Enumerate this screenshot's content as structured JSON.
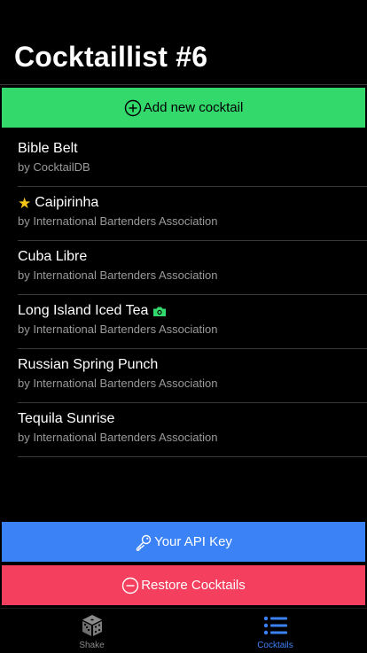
{
  "page": {
    "title": "Cocktaillist #6"
  },
  "actions": {
    "add_label": "Add new cocktail",
    "api_key_label": "Your API Key",
    "restore_label": "Restore Cocktails"
  },
  "cocktails": [
    {
      "name": "Bible Belt",
      "author": "by CocktailDB",
      "favorite": false,
      "photo": false
    },
    {
      "name": "Caipirinha",
      "author": "by International Bartenders Association",
      "favorite": true,
      "photo": false
    },
    {
      "name": "Cuba Libre",
      "author": "by International Bartenders Association",
      "favorite": false,
      "photo": false
    },
    {
      "name": "Long Island Iced Tea",
      "author": "by International Bartenders Association",
      "favorite": false,
      "photo": true
    },
    {
      "name": "Russian Spring Punch",
      "author": "by International Bartenders Association",
      "favorite": false,
      "photo": false
    },
    {
      "name": "Tequila Sunrise",
      "author": "by International Bartenders Association",
      "favorite": false,
      "photo": false
    }
  ],
  "tabs": {
    "shake": {
      "label": "Shake",
      "icon": "dice-icon",
      "active": false
    },
    "cocktails": {
      "label": "Cocktails",
      "icon": "list-icon",
      "active": true
    }
  },
  "colors": {
    "add": "#33d96a",
    "api": "#3b82f6",
    "restore": "#f43f5e",
    "active_tab": "#3b82f6",
    "star": "#f5c518",
    "camera": "#33d96a"
  }
}
